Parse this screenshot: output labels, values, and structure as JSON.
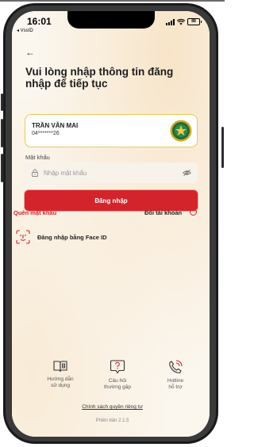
{
  "status_bar": {
    "time": "16:01",
    "back_app": "◂ VssID",
    "battery": "88"
  },
  "header": {
    "back_icon": "back-arrow-icon",
    "title": "Vui lòng nhập thông tin đăng nhập để tiếp tục"
  },
  "account": {
    "name": "TRẦN VĂN MAI",
    "phone_masked": "04*******26",
    "emblem_icon": "vss-emblem-icon"
  },
  "password": {
    "label": "Mật khẩu",
    "placeholder": "Nhập mật khẩu",
    "value": ""
  },
  "login_button": {
    "label": "Đăng nhập"
  },
  "links": {
    "forgot_password": "Quên mật khẩu",
    "switch_account": "Đổi tài khoản"
  },
  "face_id": {
    "label": "Đăng nhập bằng Face ID"
  },
  "bottom_links": [
    {
      "icon": "book-info-icon",
      "label": "Hướng dẫn\nsử dụng"
    },
    {
      "icon": "question-icon",
      "label": "Câu hỏi\nthường gặp"
    },
    {
      "icon": "phone-call-icon",
      "label": "Hotline\nhỗ trợ"
    }
  ],
  "footer": {
    "privacy": "Chính sách quyền riêng tư",
    "version": "Phiên bản 2.1.5"
  },
  "colors": {
    "accent_red": "#d3242b",
    "card_border": "#eac85a",
    "background": "#fbf6ee"
  }
}
